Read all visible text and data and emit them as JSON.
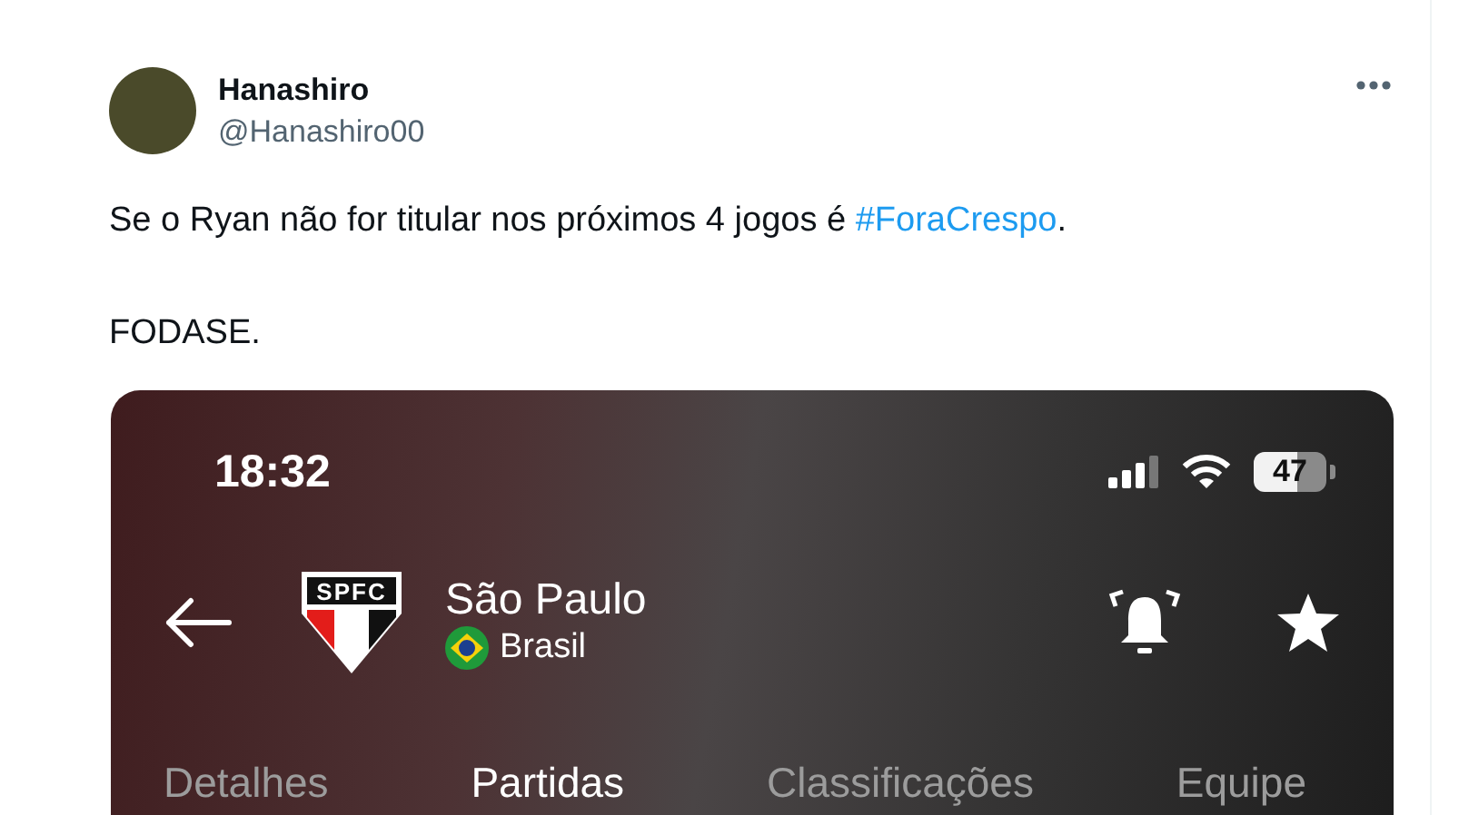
{
  "author": {
    "name": "Hanashiro",
    "handle": "@Hanashiro00"
  },
  "tweet": {
    "paragraphs": [
      {
        "parts": [
          {
            "kind": "text",
            "text": "Se o Ryan não for titular nos próximos 4 jogos é "
          },
          {
            "kind": "hashtag",
            "text": "#ForaCrespo"
          },
          {
            "kind": "text",
            "text": "."
          }
        ]
      },
      {
        "parts": [
          {
            "kind": "text",
            "text": "FODASE."
          }
        ]
      }
    ]
  },
  "screenshot": {
    "status_bar": {
      "time": "18:32",
      "battery": "47"
    },
    "team": {
      "crest_text": "SPFC",
      "name": "São Paulo",
      "country": "Brasil"
    },
    "tabs": [
      {
        "label": "Detalhes",
        "selected": false
      },
      {
        "label": "Partidas",
        "selected": true
      },
      {
        "label": "Classificações",
        "selected": false
      },
      {
        "label": "Equipe",
        "selected": false
      }
    ]
  }
}
